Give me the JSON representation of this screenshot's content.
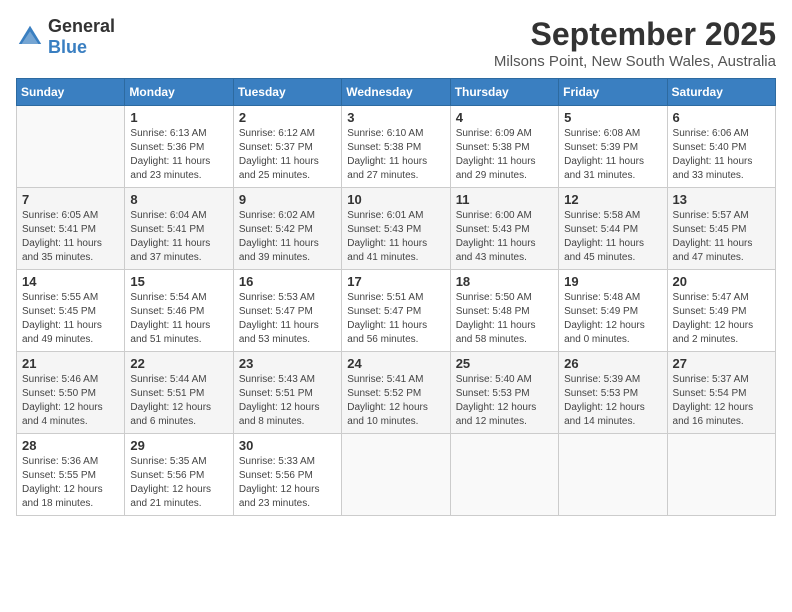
{
  "logo": {
    "text_general": "General",
    "text_blue": "Blue"
  },
  "title": "September 2025",
  "location": "Milsons Point, New South Wales, Australia",
  "days_of_week": [
    "Sunday",
    "Monday",
    "Tuesday",
    "Wednesday",
    "Thursday",
    "Friday",
    "Saturday"
  ],
  "weeks": [
    [
      {
        "day": "",
        "sunrise": "",
        "sunset": "",
        "daylight": "",
        "empty": true
      },
      {
        "day": "1",
        "sunrise": "6:13 AM",
        "sunset": "5:36 PM",
        "daylight": "11 hours and 23 minutes.",
        "empty": false
      },
      {
        "day": "2",
        "sunrise": "6:12 AM",
        "sunset": "5:37 PM",
        "daylight": "11 hours and 25 minutes.",
        "empty": false
      },
      {
        "day": "3",
        "sunrise": "6:10 AM",
        "sunset": "5:38 PM",
        "daylight": "11 hours and 27 minutes.",
        "empty": false
      },
      {
        "day": "4",
        "sunrise": "6:09 AM",
        "sunset": "5:38 PM",
        "daylight": "11 hours and 29 minutes.",
        "empty": false
      },
      {
        "day": "5",
        "sunrise": "6:08 AM",
        "sunset": "5:39 PM",
        "daylight": "11 hours and 31 minutes.",
        "empty": false
      },
      {
        "day": "6",
        "sunrise": "6:06 AM",
        "sunset": "5:40 PM",
        "daylight": "11 hours and 33 minutes.",
        "empty": false
      }
    ],
    [
      {
        "day": "7",
        "sunrise": "6:05 AM",
        "sunset": "5:41 PM",
        "daylight": "11 hours and 35 minutes.",
        "empty": false
      },
      {
        "day": "8",
        "sunrise": "6:04 AM",
        "sunset": "5:41 PM",
        "daylight": "11 hours and 37 minutes.",
        "empty": false
      },
      {
        "day": "9",
        "sunrise": "6:02 AM",
        "sunset": "5:42 PM",
        "daylight": "11 hours and 39 minutes.",
        "empty": false
      },
      {
        "day": "10",
        "sunrise": "6:01 AM",
        "sunset": "5:43 PM",
        "daylight": "11 hours and 41 minutes.",
        "empty": false
      },
      {
        "day": "11",
        "sunrise": "6:00 AM",
        "sunset": "5:43 PM",
        "daylight": "11 hours and 43 minutes.",
        "empty": false
      },
      {
        "day": "12",
        "sunrise": "5:58 AM",
        "sunset": "5:44 PM",
        "daylight": "11 hours and 45 minutes.",
        "empty": false
      },
      {
        "day": "13",
        "sunrise": "5:57 AM",
        "sunset": "5:45 PM",
        "daylight": "11 hours and 47 minutes.",
        "empty": false
      }
    ],
    [
      {
        "day": "14",
        "sunrise": "5:55 AM",
        "sunset": "5:45 PM",
        "daylight": "11 hours and 49 minutes.",
        "empty": false
      },
      {
        "day": "15",
        "sunrise": "5:54 AM",
        "sunset": "5:46 PM",
        "daylight": "11 hours and 51 minutes.",
        "empty": false
      },
      {
        "day": "16",
        "sunrise": "5:53 AM",
        "sunset": "5:47 PM",
        "daylight": "11 hours and 53 minutes.",
        "empty": false
      },
      {
        "day": "17",
        "sunrise": "5:51 AM",
        "sunset": "5:47 PM",
        "daylight": "11 hours and 56 minutes.",
        "empty": false
      },
      {
        "day": "18",
        "sunrise": "5:50 AM",
        "sunset": "5:48 PM",
        "daylight": "11 hours and 58 minutes.",
        "empty": false
      },
      {
        "day": "19",
        "sunrise": "5:48 AM",
        "sunset": "5:49 PM",
        "daylight": "12 hours and 0 minutes.",
        "empty": false
      },
      {
        "day": "20",
        "sunrise": "5:47 AM",
        "sunset": "5:49 PM",
        "daylight": "12 hours and 2 minutes.",
        "empty": false
      }
    ],
    [
      {
        "day": "21",
        "sunrise": "5:46 AM",
        "sunset": "5:50 PM",
        "daylight": "12 hours and 4 minutes.",
        "empty": false
      },
      {
        "day": "22",
        "sunrise": "5:44 AM",
        "sunset": "5:51 PM",
        "daylight": "12 hours and 6 minutes.",
        "empty": false
      },
      {
        "day": "23",
        "sunrise": "5:43 AM",
        "sunset": "5:51 PM",
        "daylight": "12 hours and 8 minutes.",
        "empty": false
      },
      {
        "day": "24",
        "sunrise": "5:41 AM",
        "sunset": "5:52 PM",
        "daylight": "12 hours and 10 minutes.",
        "empty": false
      },
      {
        "day": "25",
        "sunrise": "5:40 AM",
        "sunset": "5:53 PM",
        "daylight": "12 hours and 12 minutes.",
        "empty": false
      },
      {
        "day": "26",
        "sunrise": "5:39 AM",
        "sunset": "5:53 PM",
        "daylight": "12 hours and 14 minutes.",
        "empty": false
      },
      {
        "day": "27",
        "sunrise": "5:37 AM",
        "sunset": "5:54 PM",
        "daylight": "12 hours and 16 minutes.",
        "empty": false
      }
    ],
    [
      {
        "day": "28",
        "sunrise": "5:36 AM",
        "sunset": "5:55 PM",
        "daylight": "12 hours and 18 minutes.",
        "empty": false
      },
      {
        "day": "29",
        "sunrise": "5:35 AM",
        "sunset": "5:56 PM",
        "daylight": "12 hours and 21 minutes.",
        "empty": false
      },
      {
        "day": "30",
        "sunrise": "5:33 AM",
        "sunset": "5:56 PM",
        "daylight": "12 hours and 23 minutes.",
        "empty": false
      },
      {
        "day": "",
        "sunrise": "",
        "sunset": "",
        "daylight": "",
        "empty": true
      },
      {
        "day": "",
        "sunrise": "",
        "sunset": "",
        "daylight": "",
        "empty": true
      },
      {
        "day": "",
        "sunrise": "",
        "sunset": "",
        "daylight": "",
        "empty": true
      },
      {
        "day": "",
        "sunrise": "",
        "sunset": "",
        "daylight": "",
        "empty": true
      }
    ]
  ]
}
